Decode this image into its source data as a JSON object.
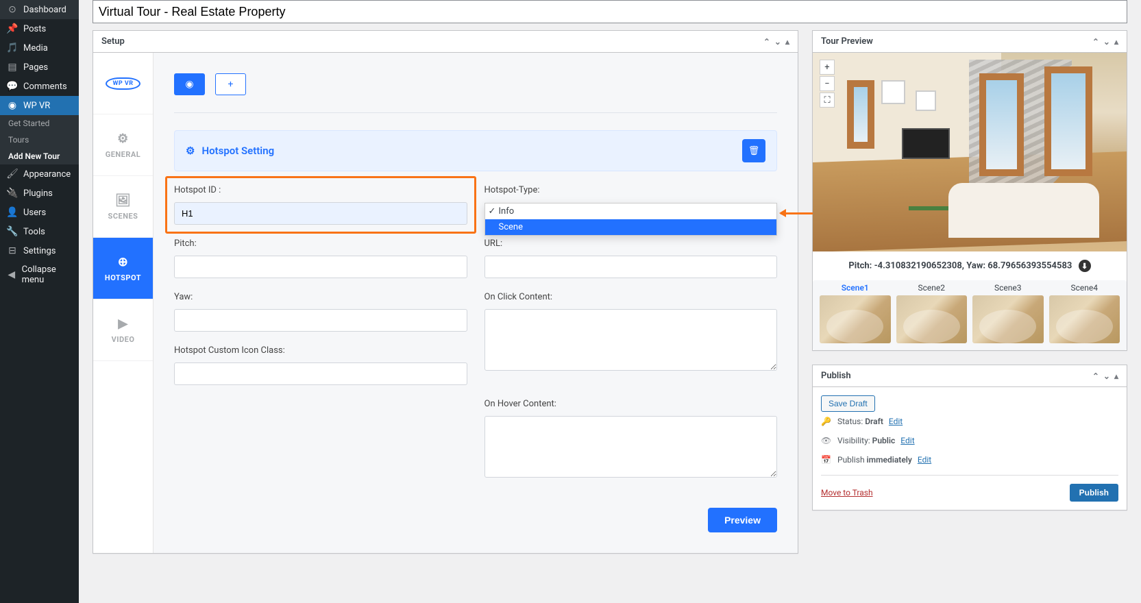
{
  "sidebar": {
    "items": [
      {
        "icon": "⌂",
        "label": "Dashboard"
      },
      {
        "icon": "✎",
        "label": "Posts"
      },
      {
        "icon": "⊞",
        "label": "Media"
      },
      {
        "icon": "▤",
        "label": "Pages"
      },
      {
        "icon": "✉",
        "label": "Comments"
      },
      {
        "icon": "◉",
        "label": "WP VR"
      }
    ],
    "subitems": [
      {
        "label": "Get Started",
        "bold": false
      },
      {
        "label": "Tours",
        "bold": false
      },
      {
        "label": "Add New Tour",
        "bold": true
      }
    ],
    "items2": [
      {
        "icon": "✦",
        "label": "Appearance"
      },
      {
        "icon": "⚙",
        "label": "Plugins"
      },
      {
        "icon": "👤",
        "label": "Users"
      },
      {
        "icon": "🔧",
        "label": "Tools"
      },
      {
        "icon": "⊟",
        "label": "Settings"
      },
      {
        "icon": "◀",
        "label": "Collapse menu"
      }
    ]
  },
  "title": "Virtual Tour - Real Estate Property",
  "setup": {
    "panel_title": "Setup",
    "tabs": {
      "logo": "WP VR",
      "general": "GENERAL",
      "scenes": "SCENES",
      "hotspot": "HOTSPOT",
      "video": "VIDEO"
    },
    "section_title": "Hotspot Setting",
    "fields": {
      "hotspot_id_label": "Hotspot ID :",
      "hotspot_id_value": "H1",
      "hotspot_type_label": "Hotspot-Type:",
      "hotspot_type_options": [
        "Info",
        "Scene"
      ],
      "hotspot_type_selected": "Info",
      "pitch_label": "Pitch:",
      "pitch_value": "",
      "url_label": "URL:",
      "url_value": "",
      "yaw_label": "Yaw:",
      "yaw_value": "",
      "onclick_label": "On Click Content:",
      "onclick_value": "",
      "iconclass_label": "Hotspot Custom Icon Class:",
      "iconclass_value": "",
      "onhover_label": "On Hover Content:",
      "onhover_value": ""
    },
    "preview_btn": "Preview"
  },
  "tour_preview": {
    "panel_title": "Tour Preview",
    "pitch_label": "Pitch: ",
    "pitch_value": "-4.310832190652308",
    "yaw_label": ", Yaw: ",
    "yaw_value": "68.79656393554583",
    "scenes": [
      "Scene1",
      "Scene2",
      "Scene3",
      "Scene4"
    ]
  },
  "publish": {
    "panel_title": "Publish",
    "save_draft": "Save Draft",
    "status_label": "Status: ",
    "status_value": "Draft",
    "visibility_label": "Visibility: ",
    "visibility_value": "Public",
    "schedule_label": "Publish ",
    "schedule_value": "immediately",
    "edit": "Edit",
    "trash": "Move to Trash",
    "publish_btn": "Publish"
  }
}
